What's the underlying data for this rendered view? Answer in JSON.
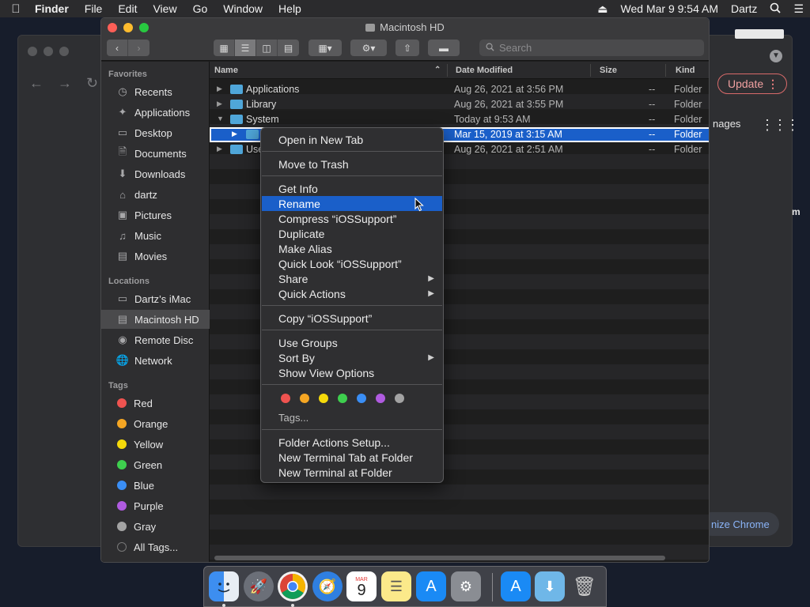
{
  "menubar": {
    "app": "Finder",
    "items": [
      "File",
      "Edit",
      "View",
      "Go",
      "Window",
      "Help"
    ],
    "clock": "Wed Mar 9  9:54 AM",
    "user": "Dartz"
  },
  "chrome": {
    "update_label": "Update",
    "images_text": "nages",
    "m_text": "m",
    "customize_text": "nize Chrome"
  },
  "finder": {
    "title": "Macintosh HD",
    "search_placeholder": "Search",
    "sidebar": {
      "favorites_header": "Favorites",
      "favorites": [
        {
          "label": "Recents",
          "icon": "clock-icon"
        },
        {
          "label": "Applications",
          "icon": "applications-icon"
        },
        {
          "label": "Desktop",
          "icon": "desktop-icon"
        },
        {
          "label": "Documents",
          "icon": "documents-icon"
        },
        {
          "label": "Downloads",
          "icon": "downloads-icon"
        },
        {
          "label": "dartz",
          "icon": "home-icon"
        },
        {
          "label": "Pictures",
          "icon": "camera-icon"
        },
        {
          "label": "Music",
          "icon": "music-icon"
        },
        {
          "label": "Movies",
          "icon": "film-icon"
        }
      ],
      "locations_header": "Locations",
      "locations": [
        {
          "label": "Dartz’s iMac",
          "icon": "imac-icon"
        },
        {
          "label": "Macintosh HD",
          "icon": "disk-icon"
        },
        {
          "label": "Remote Disc",
          "icon": "disc-icon"
        },
        {
          "label": "Network",
          "icon": "globe-icon"
        }
      ],
      "tags_header": "Tags",
      "tags": [
        {
          "label": "Red",
          "color": "#ef5350"
        },
        {
          "label": "Orange",
          "color": "#f5a623"
        },
        {
          "label": "Yellow",
          "color": "#f5d90a"
        },
        {
          "label": "Green",
          "color": "#3ecf4e"
        },
        {
          "label": "Blue",
          "color": "#3a8ef5"
        },
        {
          "label": "Purple",
          "color": "#b05be0"
        },
        {
          "label": "Gray",
          "color": "#a3a3a3"
        },
        {
          "label": "All Tags...",
          "color": "#555555"
        }
      ]
    },
    "columns": {
      "name": "Name",
      "date": "Date Modified",
      "size": "Size",
      "kind": "Kind"
    },
    "rows": [
      {
        "name": "Applications",
        "date": "Aug 26, 2021 at 3:56 PM",
        "size": "--",
        "kind": "Folder"
      },
      {
        "name": "Library",
        "date": "Aug 26, 2021 at 3:55 PM",
        "size": "--",
        "kind": "Folder"
      },
      {
        "name": "System",
        "date": "Today at 9:53 AM",
        "size": "--",
        "kind": "Folder"
      },
      {
        "name": "",
        "date": "Mar 15, 2019 at 3:15 AM",
        "size": "--",
        "kind": "Folder"
      },
      {
        "name": "Use",
        "date": "Aug 26, 2021 at 2:51 AM",
        "size": "--",
        "kind": "Folder"
      }
    ]
  },
  "context_menu": {
    "open_new_tab": "Open in New Tab",
    "move_trash": "Move to Trash",
    "get_info": "Get Info",
    "rename": "Rename",
    "compress": "Compress “iOSSupport”",
    "duplicate": "Duplicate",
    "make_alias": "Make Alias",
    "quick_look": "Quick Look “iOSSupport”",
    "share": "Share",
    "quick_actions": "Quick Actions",
    "copy": "Copy “iOSSupport”",
    "use_groups": "Use Groups",
    "sort_by": "Sort By",
    "show_view_options": "Show View Options",
    "tag_colors": [
      "#ef5350",
      "#f5a623",
      "#f5d90a",
      "#3ecf4e",
      "#3a8ef5",
      "#b05be0",
      "#a3a3a3"
    ],
    "tags": "Tags...",
    "folder_actions": "Folder Actions Setup...",
    "new_terminal_tab": "New Terminal Tab at Folder",
    "new_terminal": "New Terminal at Folder"
  },
  "dock": {
    "calendar_month": "MAR",
    "calendar_day": "9"
  }
}
